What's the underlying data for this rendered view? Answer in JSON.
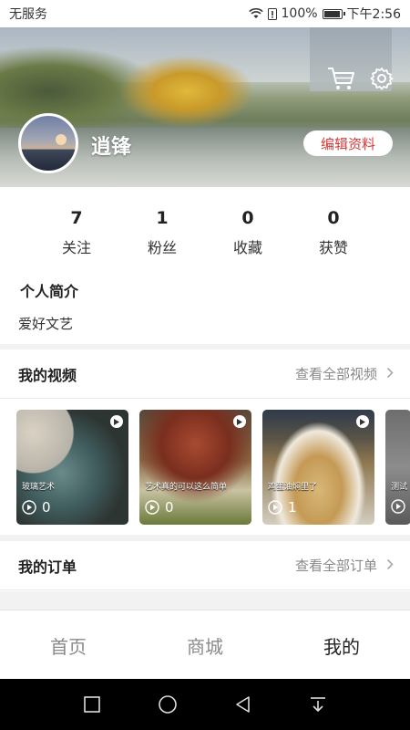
{
  "status_bar": {
    "carrier": "无服务",
    "battery": "100%",
    "time": "下午2:56"
  },
  "profile": {
    "username": "逍锋",
    "edit_label": "编辑资料"
  },
  "stats": [
    {
      "value": "7",
      "label": "关注"
    },
    {
      "value": "1",
      "label": "粉丝"
    },
    {
      "value": "0",
      "label": "收藏"
    },
    {
      "value": "0",
      "label": "获赞"
    }
  ],
  "bio": {
    "title": "个人简介",
    "text": "爱好文艺"
  },
  "videos": {
    "title": "我的视频",
    "more": "查看全部视频",
    "items": [
      {
        "caption": "玻璃艺术",
        "count": "0"
      },
      {
        "caption": "艺术真的可以这么简单",
        "count": "0"
      },
      {
        "caption": "鸡蛋油焖里了",
        "count": "1"
      },
      {
        "caption": "测试",
        "count": ""
      }
    ]
  },
  "orders": {
    "title": "我的订单",
    "more": "查看全部订单"
  },
  "tabs": [
    {
      "label": "首页"
    },
    {
      "label": "商城"
    },
    {
      "label": "我的"
    }
  ],
  "colors": {
    "accent": "#d23b3b",
    "active_tab": "#222222",
    "inactive_tab": "#8a8a8a"
  }
}
